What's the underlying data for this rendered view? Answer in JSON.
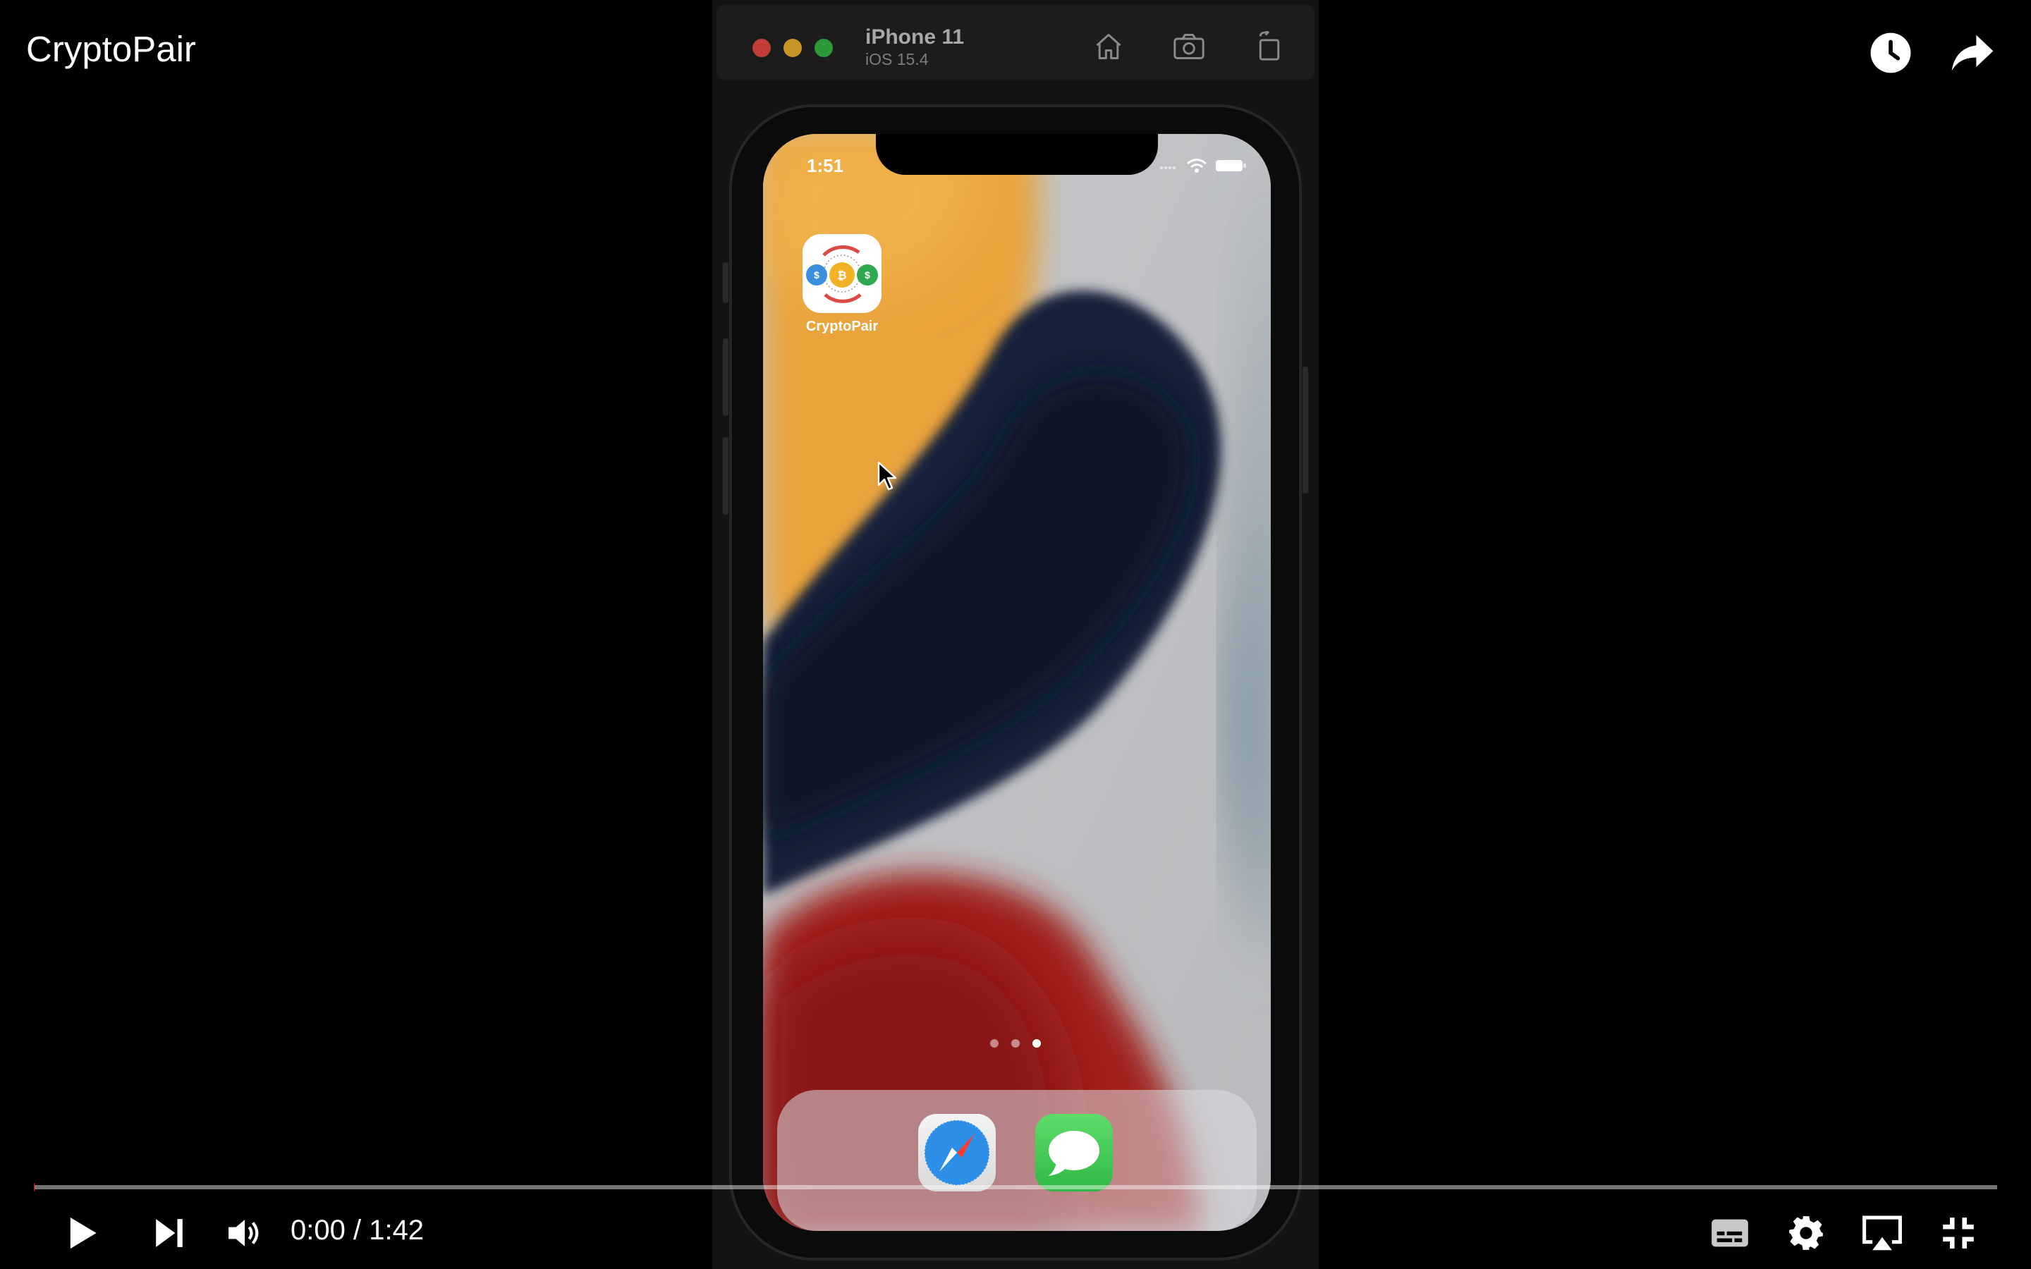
{
  "player": {
    "title": "CryptoPair",
    "time_current": "0:00",
    "time_separator": " / ",
    "time_total": "1:42",
    "progress_fraction": 0.0
  },
  "simulator": {
    "device_name": "iPhone 11",
    "os_version": "iOS 15.4"
  },
  "phone": {
    "status_time": "1:51",
    "home_apps": [
      {
        "label": "CryptoPair",
        "icon": "cryptopair-app-icon"
      }
    ],
    "dock_apps": [
      {
        "label": "Safari",
        "icon": "safari-icon"
      },
      {
        "label": "Messages",
        "icon": "messages-icon"
      }
    ],
    "page_count": 3,
    "active_page": 3
  },
  "colors": {
    "background": "#000000",
    "wallpaper_orange": "#e8a23a",
    "wallpaper_navy": "#16213a",
    "wallpaper_red": "#a0201e",
    "wallpaper_teal": "#5f7f90",
    "messages_green": "#35c94e",
    "traffic_red": "#e0443e",
    "traffic_yellow": "#dea123",
    "traffic_green": "#2aac3a"
  }
}
